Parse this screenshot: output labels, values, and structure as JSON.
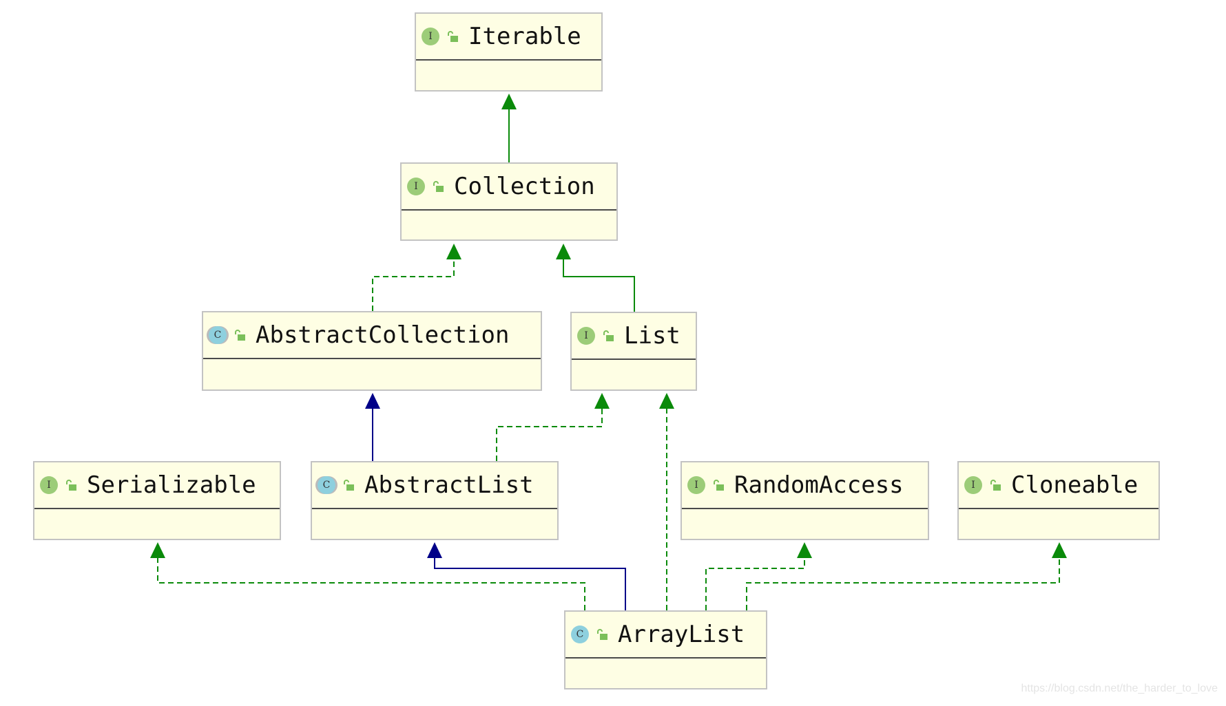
{
  "colors": {
    "realization": "#0a8a0a",
    "extends_class": "#000088",
    "node_fill": "#fefee4",
    "interface_badge": "#9ccc78",
    "class_badge": "#8ed0de"
  },
  "nodes": [
    {
      "id": "iterable",
      "name": "Iterable",
      "kind": "interface",
      "badge": "I"
    },
    {
      "id": "collection",
      "name": "Collection",
      "kind": "interface",
      "badge": "I"
    },
    {
      "id": "abstractcollection",
      "name": "AbstractCollection",
      "kind": "abstract-class",
      "badge": "C"
    },
    {
      "id": "list",
      "name": "List",
      "kind": "interface",
      "badge": "I"
    },
    {
      "id": "serializable",
      "name": "Serializable",
      "kind": "interface",
      "badge": "I"
    },
    {
      "id": "abstractlist",
      "name": "AbstractList",
      "kind": "abstract-class",
      "badge": "C"
    },
    {
      "id": "randomaccess",
      "name": "RandomAccess",
      "kind": "interface",
      "badge": "I"
    },
    {
      "id": "cloneable",
      "name": "Cloneable",
      "kind": "interface",
      "badge": "I"
    },
    {
      "id": "arraylist",
      "name": "ArrayList",
      "kind": "class",
      "badge": "C"
    }
  ],
  "edges": [
    {
      "from": "collection",
      "to": "iterable",
      "style": "solid-green"
    },
    {
      "from": "abstractcollection",
      "to": "collection",
      "style": "dashed-green"
    },
    {
      "from": "list",
      "to": "collection",
      "style": "solid-green"
    },
    {
      "from": "abstractlist",
      "to": "abstractcollection",
      "style": "solid-blue"
    },
    {
      "from": "abstractlist",
      "to": "list",
      "style": "dashed-green"
    },
    {
      "from": "arraylist",
      "to": "list",
      "style": "dashed-green"
    },
    {
      "from": "arraylist",
      "to": "serializable",
      "style": "dashed-green"
    },
    {
      "from": "arraylist",
      "to": "abstractlist",
      "style": "solid-blue"
    },
    {
      "from": "arraylist",
      "to": "randomaccess",
      "style": "dashed-green"
    },
    {
      "from": "arraylist",
      "to": "cloneable",
      "style": "dashed-green"
    }
  ],
  "watermark": "https://blog.csdn.net/the_harder_to_love"
}
